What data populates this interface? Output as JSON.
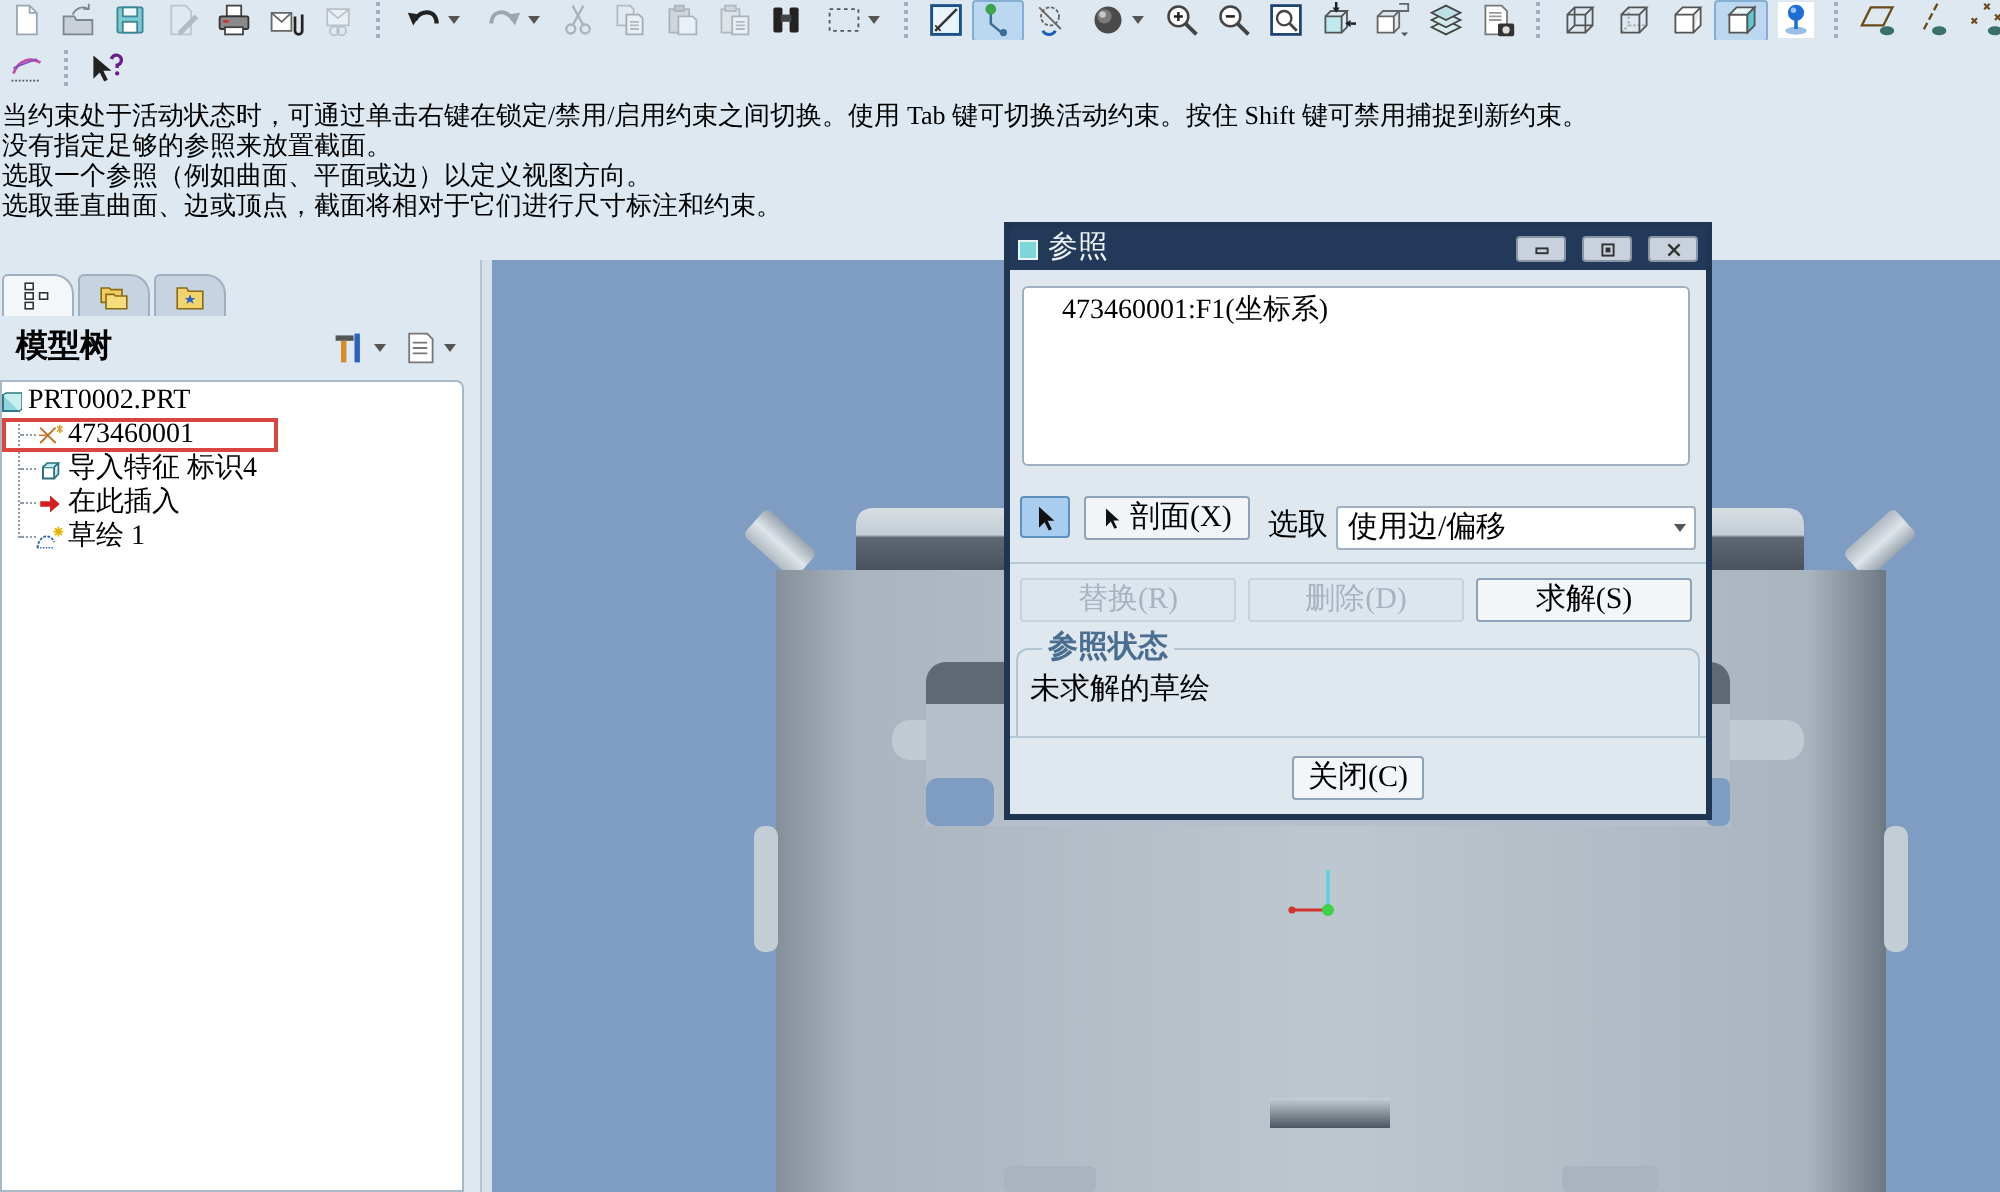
{
  "toolbar": {
    "rows": [
      [
        {
          "pressed": false,
          "disabled": false
        },
        {
          "pressed": false,
          "disabled": false
        },
        {
          "pressed": false,
          "disabled": false
        },
        {
          "pressed": false,
          "disabled": true
        },
        {
          "pressed": false,
          "disabled": false
        },
        {
          "pressed": false,
          "disabled": false
        },
        {
          "pressed": false,
          "disabled": true
        },
        {
          "pressed": false,
          "disabled": false
        },
        {
          "pressed": false,
          "disabled": true
        },
        {
          "pressed": false,
          "disabled": true
        },
        {
          "pressed": false,
          "disabled": true
        },
        {
          "pressed": false,
          "disabled": true
        },
        {
          "pressed": false,
          "disabled": true
        },
        {
          "pressed": false,
          "disabled": false
        },
        {
          "pressed": false,
          "disabled": false
        },
        {
          "pressed": false,
          "disabled": false
        },
        {
          "pressed": true,
          "disabled": false
        },
        {
          "pressed": false,
          "disabled": false
        },
        {
          "pressed": false,
          "disabled": false
        },
        {
          "pressed": false,
          "disabled": false
        },
        {
          "pressed": false,
          "disabled": false
        },
        {
          "pressed": false,
          "disabled": false
        },
        {
          "pressed": false,
          "disabled": false
        },
        {
          "pressed": false,
          "disabled": false
        },
        {
          "pressed": false,
          "disabled": false
        },
        {
          "pressed": false,
          "disabled": false
        },
        {
          "pressed": false,
          "disabled": false
        },
        {
          "pressed": false,
          "disabled": false
        },
        {
          "pressed": false,
          "disabled": false
        },
        {
          "pressed": true,
          "disabled": false
        },
        {
          "pressed": false,
          "disabled": false
        },
        {
          "pressed": false,
          "disabled": false
        },
        {
          "pressed": false,
          "disabled": false
        },
        {
          "pressed": false,
          "disabled": false
        }
      ],
      [
        {
          "pressed": false,
          "disabled": false
        },
        {
          "pressed": false,
          "disabled": false
        }
      ]
    ]
  },
  "messages": [
    "当约束处于活动状态时，可通过单击右键在锁定/禁用/启用约束之间切换。使用 Tab 键可切换活动约束。按住 Shift 键可禁用捕捉到新约束。",
    "没有指定足够的参照来放置截面。",
    "选取一个参照（例如曲面、平面或边）以定义视图方向。",
    "选取垂直曲面、边或顶点，截面将相对于它们进行尺寸标注和约束。"
  ],
  "navigator_tabs": [
    {
      "selected": true
    },
    {
      "selected": false
    },
    {
      "selected": false
    }
  ],
  "model_tree": {
    "title": "模型树",
    "root": {
      "label": "PRT0002.PRT",
      "children": [
        {
          "label": "473460001",
          "kind": "csys",
          "marked": true
        },
        {
          "label": "导入特征 标识4",
          "kind": "import",
          "marked": false
        },
        {
          "label": "在此插入",
          "kind": "insert",
          "marked": false
        },
        {
          "label": "草绘 1",
          "kind": "sketch",
          "marked": false
        }
      ]
    }
  },
  "dialog": {
    "title": "参照",
    "references": [
      "473460001:F1(坐标系)"
    ],
    "pick_toggle": {
      "selected": true
    },
    "section_button": "剖面(X)",
    "select_label": "选取",
    "select_value": "使用边/偏移",
    "actions": [
      {
        "label": "替换(R)",
        "disabled": true
      },
      {
        "label": "删除(D)",
        "disabled": true
      },
      {
        "label": "求解(S)",
        "disabled": false
      }
    ],
    "status_group": {
      "title": "参照状态",
      "text": "未求解的草绘"
    },
    "close_button": "关闭(C)"
  }
}
